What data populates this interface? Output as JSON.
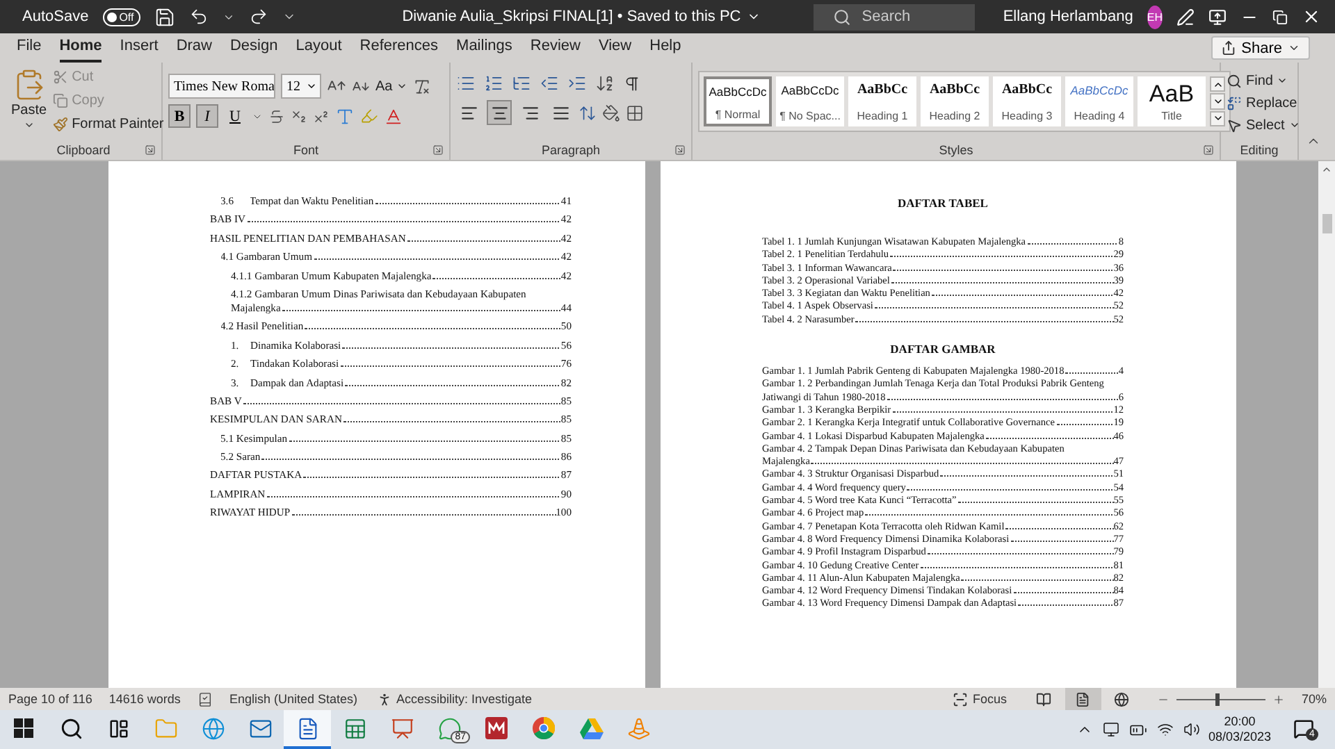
{
  "title_bar": {
    "autosave_label": "AutoSave",
    "autosave_toggle": {
      "label": "Off",
      "on": false
    },
    "document_title": "Diwanie Aulia_Skripsi FINAL[1] • Saved to this PC",
    "search": {
      "placeholder": "Search"
    },
    "user_name": "Ellang Herlambang",
    "avatar_initials": "EH"
  },
  "menu_tabs": [
    {
      "label": "File",
      "selected": false
    },
    {
      "label": "Home",
      "selected": true
    },
    {
      "label": "Insert",
      "selected": false
    },
    {
      "label": "Draw",
      "selected": false
    },
    {
      "label": "Design",
      "selected": false
    },
    {
      "label": "Layout",
      "selected": false
    },
    {
      "label": "References",
      "selected": false
    },
    {
      "label": "Mailings",
      "selected": false
    },
    {
      "label": "Review",
      "selected": false
    },
    {
      "label": "View",
      "selected": false
    },
    {
      "label": "Help",
      "selected": false
    }
  ],
  "share": "Share",
  "ribbon": {
    "clipboard": {
      "paste": "Paste",
      "cut": "Cut",
      "copy": "Copy",
      "format_painter": "Format Painter",
      "group_label": "Clipboard"
    },
    "font": {
      "font_name": "Times New Roma",
      "font_size": "12",
      "case_label": "Aa",
      "format_buttons": [
        {
          "label": "B",
          "kind": "bold",
          "selected": true
        },
        {
          "label": "I",
          "kind": "italic",
          "selected": true
        },
        {
          "label": "U",
          "kind": "underline",
          "selected": false
        }
      ],
      "group_label": "Font"
    },
    "paragraph": {
      "alignments": [
        {
          "kind": "left",
          "selected": false
        },
        {
          "kind": "center",
          "selected": true
        },
        {
          "kind": "right",
          "selected": false
        },
        {
          "kind": "justify",
          "selected": false
        }
      ],
      "group_label": "Paragraph"
    },
    "styles": {
      "items": [
        {
          "preview": "AaBbCcDc",
          "name": "¶ Normal",
          "kind": "plain",
          "selected": true
        },
        {
          "preview": "AaBbCcDc",
          "name": "¶ No Spac...",
          "kind": "plain",
          "selected": false
        },
        {
          "preview": "AaBbCc",
          "name": "Heading 1",
          "kind": "bold",
          "selected": false
        },
        {
          "preview": "AaBbCc",
          "name": "Heading 2",
          "kind": "bold",
          "selected": false
        },
        {
          "preview": "AaBbCc",
          "name": "Heading 3",
          "kind": "bold",
          "selected": false
        },
        {
          "preview": "AaBbCcDc",
          "name": "Heading 4",
          "kind": "italic",
          "selected": false
        },
        {
          "preview": "AaB",
          "name": "Title",
          "kind": "title",
          "selected": false
        }
      ],
      "group_label": "Styles"
    },
    "editing": {
      "find": "Find",
      "replace": "Replace",
      "select": "Select",
      "group_label": "Editing"
    }
  },
  "left_page": {
    "continued": [
      {
        "number": "3.6",
        "text": "Tempat dan Waktu Penelitian",
        "page": "41"
      }
    ],
    "entries": [
      {
        "text": "BAB IV",
        "page": "42"
      },
      {
        "text": "HASIL PENELITIAN DAN PEMBAHASAN",
        "page": "42",
        "children": [
          {
            "text": "4.1 Gambaran Umum",
            "page": "42",
            "children": [
              {
                "text": "4.1.1 Gambaran Umum Kabupaten Majalengka",
                "page": "42"
              },
              {
                "text": "4.1.2 Gambaran Umum Dinas Pariwisata dan Kebudayaan Kabupaten Majalengka",
                "page": "44"
              }
            ]
          },
          {
            "text": "4.2 Hasil Penelitian",
            "page": "50",
            "children": [
              {
                "number": "1.",
                "text": "Dinamika Kolaborasi",
                "page": "56"
              },
              {
                "number": "2.",
                "text": "Tindakan Kolaborasi",
                "page": "76"
              },
              {
                "number": "3.",
                "text": "Dampak dan Adaptasi",
                "page": "82"
              }
            ]
          }
        ]
      },
      {
        "text": "BAB V",
        "page": "85"
      },
      {
        "text": "KESIMPULAN DAN SARAN",
        "page": "85",
        "children": [
          {
            "text": "5.1 Kesimpulan",
            "page": "85"
          },
          {
            "text": "5.2 Saran",
            "page": "86"
          }
        ]
      },
      {
        "text": "DAFTAR PUSTAKA",
        "page": "87"
      },
      {
        "text": "LAMPIRAN",
        "page": "90"
      },
      {
        "text": "RIWAYAT HIDUP",
        "page": "100"
      }
    ]
  },
  "right_page": {
    "tables_heading": "DAFTAR TABEL",
    "tables": [
      {
        "text": "Tabel 1. 1 Jumlah Kunjungan Wisatawan Kabupaten Majalengka",
        "page": "8"
      },
      {
        "text": "Tabel 2. 1 Penelitian Terdahulu",
        "page": "29"
      },
      {
        "text": "Tabel 3. 1 Informan Wawancara",
        "page": "36"
      },
      {
        "text": "Tabel 3. 2 Operasional Variabel",
        "page": "39"
      },
      {
        "text": "Tabel 3. 3 Kegiatan dan Waktu Penelitian",
        "page": "42"
      },
      {
        "text": "Tabel 4. 1 Aspek Observasi",
        "page": "52"
      },
      {
        "text": "Tabel 4. 2 Narasumber",
        "page": "52"
      }
    ],
    "figures_heading": "DAFTAR GAMBAR",
    "figures": [
      {
        "text": "Gambar 1. 1 Jumlah Pabrik Genteng di Kabupaten Majalengka 1980-2018",
        "page": "4"
      },
      {
        "text": "Gambar 1. 2 Perbandingan Jumlah Tenaga Kerja dan Total Produksi Pabrik Genteng Jatiwangi di Tahun 1980-2018",
        "page": "6"
      },
      {
        "text": "Gambar 1. 3 Kerangka Berpikir",
        "page": "12"
      },
      {
        "text": "Gambar 2. 1 Kerangka Kerja Integratif untuk Collaborative Governance",
        "page": "19"
      },
      {
        "text": "Gambar 4. 1 Lokasi Disparbud Kabupaten Majalengka",
        "page": "46"
      },
      {
        "text": "Gambar 4. 2 Tampak Depan Dinas Pariwisata dan Kebudayaan Kabupaten Majalengka",
        "page": "47"
      },
      {
        "text": "Gambar 4. 3 Struktur Organisasi Disparbud",
        "page": "51"
      },
      {
        "text": "Gambar 4. 4 Word frequency query",
        "page": "54"
      },
      {
        "text": "Gambar 4. 5 Word tree Kata Kunci “Terracotta”",
        "page": "55"
      },
      {
        "text": "Gambar 4. 6 Project map",
        "page": "56"
      },
      {
        "text": "Gambar 4. 7 Penetapan Kota Terracotta oleh Ridwan Kamil",
        "page": "62"
      },
      {
        "text": "Gambar 4. 8 Word Frequency Dimensi Dinamika Kolaborasi",
        "page": "77"
      },
      {
        "text": "Gambar 4. 9 Profil Instagram Disparbud",
        "page": "79"
      },
      {
        "text": "Gambar 4. 10 Gedung Creative Center",
        "page": "81"
      },
      {
        "text": "Gambar 4. 11 Alun-Alun Kabupaten Majalengka",
        "page": "82"
      },
      {
        "text": "Gambar 4. 12 Word Frequency Dimensi Tindakan Kolaborasi",
        "page": "84"
      },
      {
        "text": "Gambar 4. 13 Word Frequency Dimensi Dampak dan Adaptasi",
        "page": "87"
      }
    ]
  },
  "status_bar": {
    "page": "Page 10 of 116",
    "words": "14616 words",
    "language": "English (United States)",
    "accessibility": "Accessibility: Investigate",
    "focus": "Focus",
    "views": [
      {
        "kind": "read",
        "selected": false
      },
      {
        "kind": "print",
        "selected": true
      },
      {
        "kind": "web",
        "selected": false
      }
    ],
    "zoom": {
      "level": 0.45,
      "reading": "70%"
    }
  },
  "taskbar": {
    "apps": [
      {
        "kind": "explorer",
        "selected": false
      },
      {
        "kind": "browser",
        "selected": false
      },
      {
        "kind": "mail",
        "selected": false
      },
      {
        "kind": "word",
        "selected": true
      },
      {
        "kind": "excel",
        "selected": false
      },
      {
        "kind": "powerpoint",
        "selected": false
      },
      {
        "kind": "chat",
        "selected": false,
        "badge": "87"
      },
      {
        "kind": "reader",
        "selected": false
      },
      {
        "kind": "chrome",
        "selected": false
      },
      {
        "kind": "drive",
        "selected": false
      },
      {
        "kind": "vlc",
        "selected": false
      }
    ],
    "time": "20:00",
    "date": "08/03/2023",
    "notifications": "4"
  }
}
